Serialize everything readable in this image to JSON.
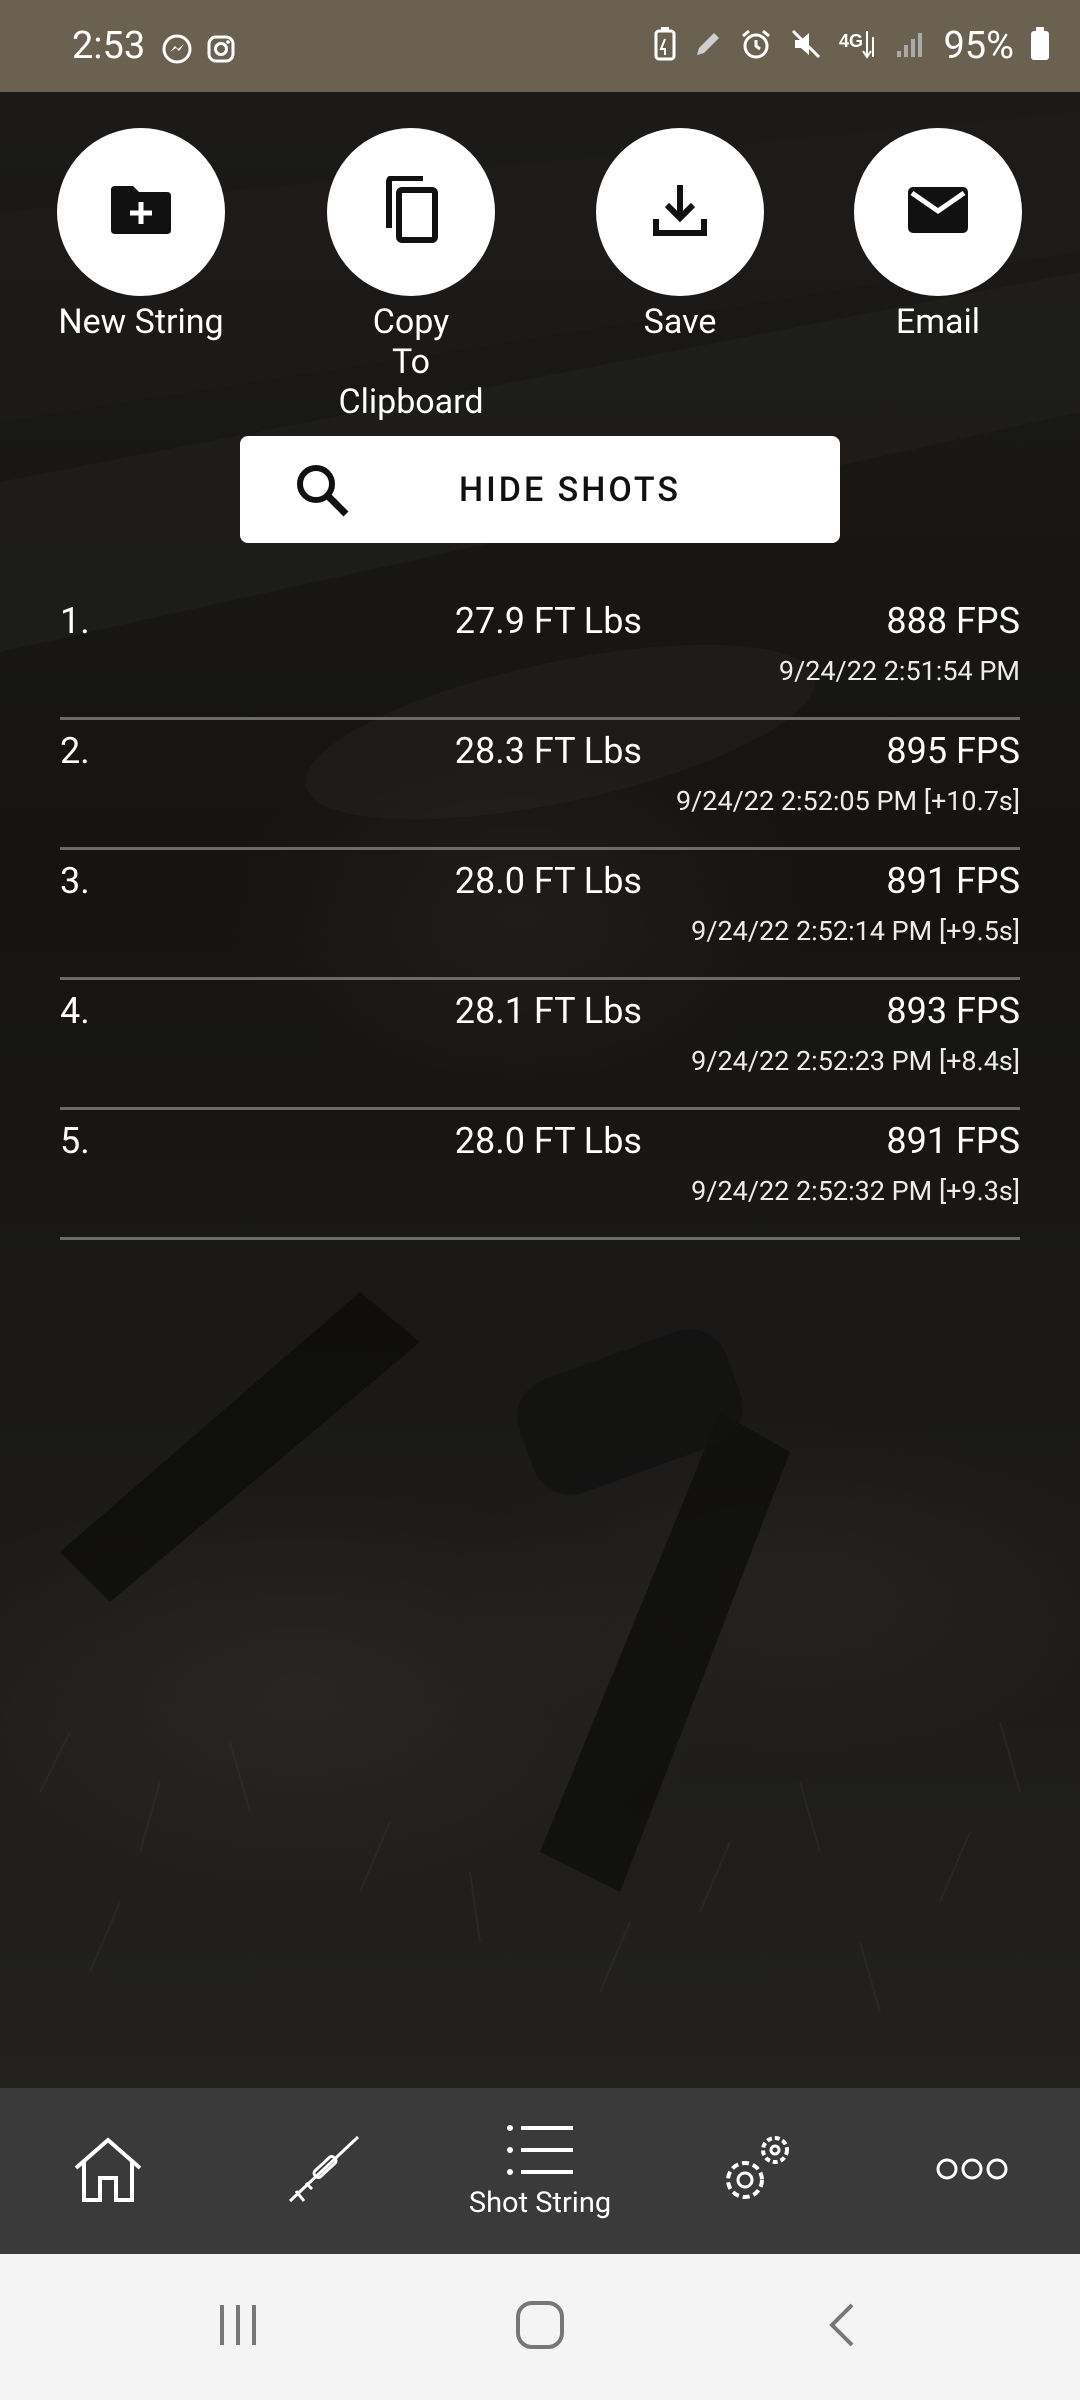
{
  "status_bar": {
    "time": "2:53",
    "battery": "95%",
    "left_icons": [
      "messenger-icon",
      "instagram-icon"
    ],
    "right_icons": [
      "battery-saver-icon",
      "pen-icon",
      "alarm-icon",
      "mute-icon",
      "lte-icon",
      "signal-icon",
      "battery-icon"
    ]
  },
  "actions": [
    {
      "label": "New String",
      "icon": "new-folder-icon"
    },
    {
      "label": "Copy\nTo Clipboard",
      "icon": "copy-icon"
    },
    {
      "label": "Save",
      "icon": "download-icon"
    },
    {
      "label": "Email",
      "icon": "email-icon"
    }
  ],
  "hide_shots": {
    "label": "HIDE SHOTS",
    "icon": "search-icon"
  },
  "shots": [
    {
      "num": "1.",
      "energy": "27.9 FT Lbs",
      "velocity": "888 FPS",
      "time": "9/24/22 2:51:54 PM"
    },
    {
      "num": "2.",
      "energy": "28.3 FT Lbs",
      "velocity": "895 FPS",
      "time": "9/24/22 2:52:05 PM [+10.7s]"
    },
    {
      "num": "3.",
      "energy": "28.0 FT Lbs",
      "velocity": "891 FPS",
      "time": "9/24/22 2:52:14 PM [+9.5s]"
    },
    {
      "num": "4.",
      "energy": "28.1 FT Lbs",
      "velocity": "893 FPS",
      "time": "9/24/22 2:52:23 PM [+8.4s]"
    },
    {
      "num": "5.",
      "energy": "28.0 FT Lbs",
      "velocity": "891 FPS",
      "time": "9/24/22 2:52:32 PM [+9.3s]"
    }
  ],
  "bottom_nav": {
    "items": [
      {
        "icon": "home-icon",
        "label": ""
      },
      {
        "icon": "rifle-icon",
        "label": ""
      },
      {
        "icon": "list-icon",
        "label": "Shot String"
      },
      {
        "icon": "settings-gears-icon",
        "label": ""
      },
      {
        "icon": "more-icon",
        "label": ""
      }
    ],
    "active_index": 2
  },
  "system_nav": [
    "recents-icon",
    "home-circle-icon",
    "back-icon"
  ],
  "colors": {
    "status_bar": "#6b6150",
    "nav_bar": "#3a3a3a",
    "row_divider": "#6b6b6b"
  }
}
